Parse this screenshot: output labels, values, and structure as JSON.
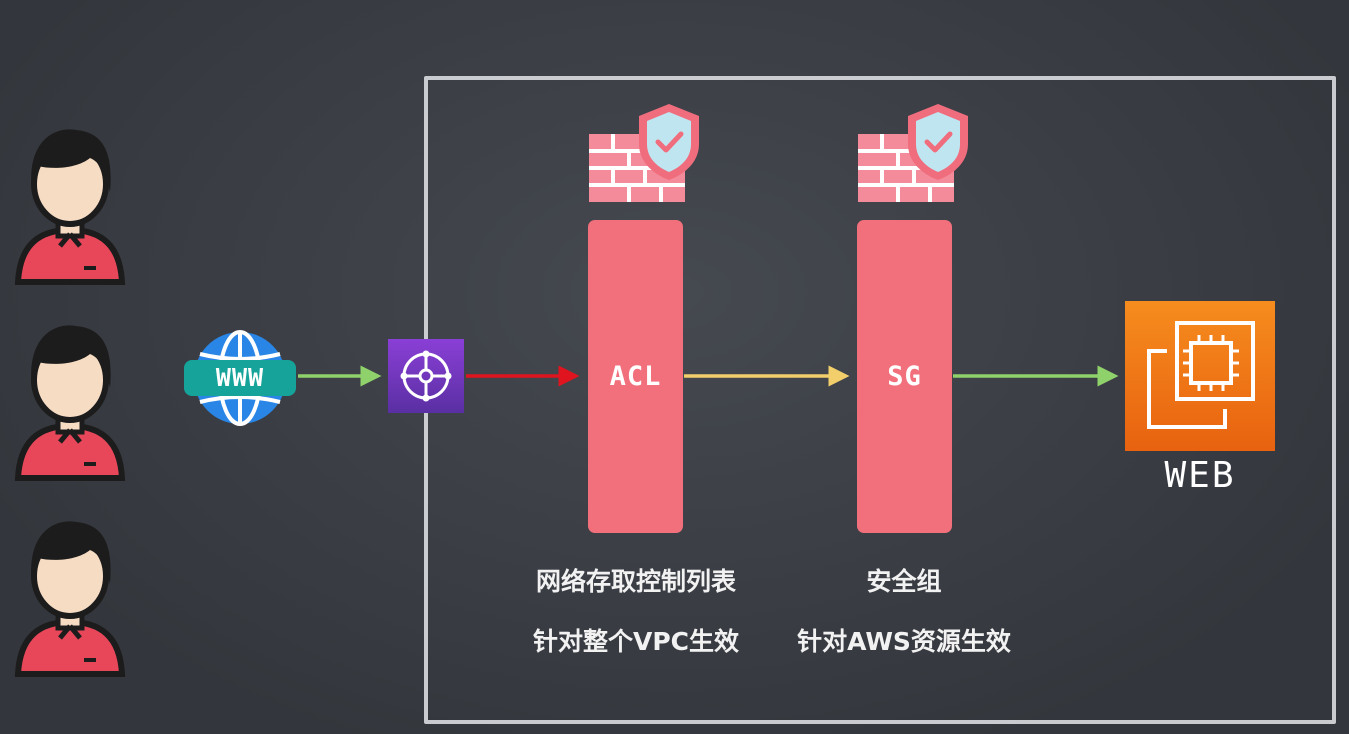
{
  "diagram": {
    "users": [
      {
        "name": "user-1"
      },
      {
        "name": "user-2"
      },
      {
        "name": "user-3"
      }
    ],
    "internet": {
      "label": "WWW"
    },
    "acl": {
      "label": "ACL",
      "title": "网络存取控制列表",
      "scope": "针对整个VPC生效"
    },
    "sg": {
      "label": "SG",
      "title": "安全组",
      "scope": "针对AWS资源生效"
    },
    "web": {
      "label": "WEB"
    },
    "colors": {
      "background": "#3e4249",
      "frame": "#d6d8dc",
      "pillar": "#f1707c",
      "arrow_green": "#8fd16a",
      "arrow_red": "#e0141e",
      "arrow_yellow": "#f2cf6b",
      "igw": "#7a36c8",
      "ec2": "#f07a17",
      "www": "#16a49a"
    },
    "icons": [
      "user-avatar-icon",
      "globe-icon",
      "internet-gateway-icon",
      "brick-wall-shield-icon",
      "ec2-chip-icon"
    ]
  }
}
